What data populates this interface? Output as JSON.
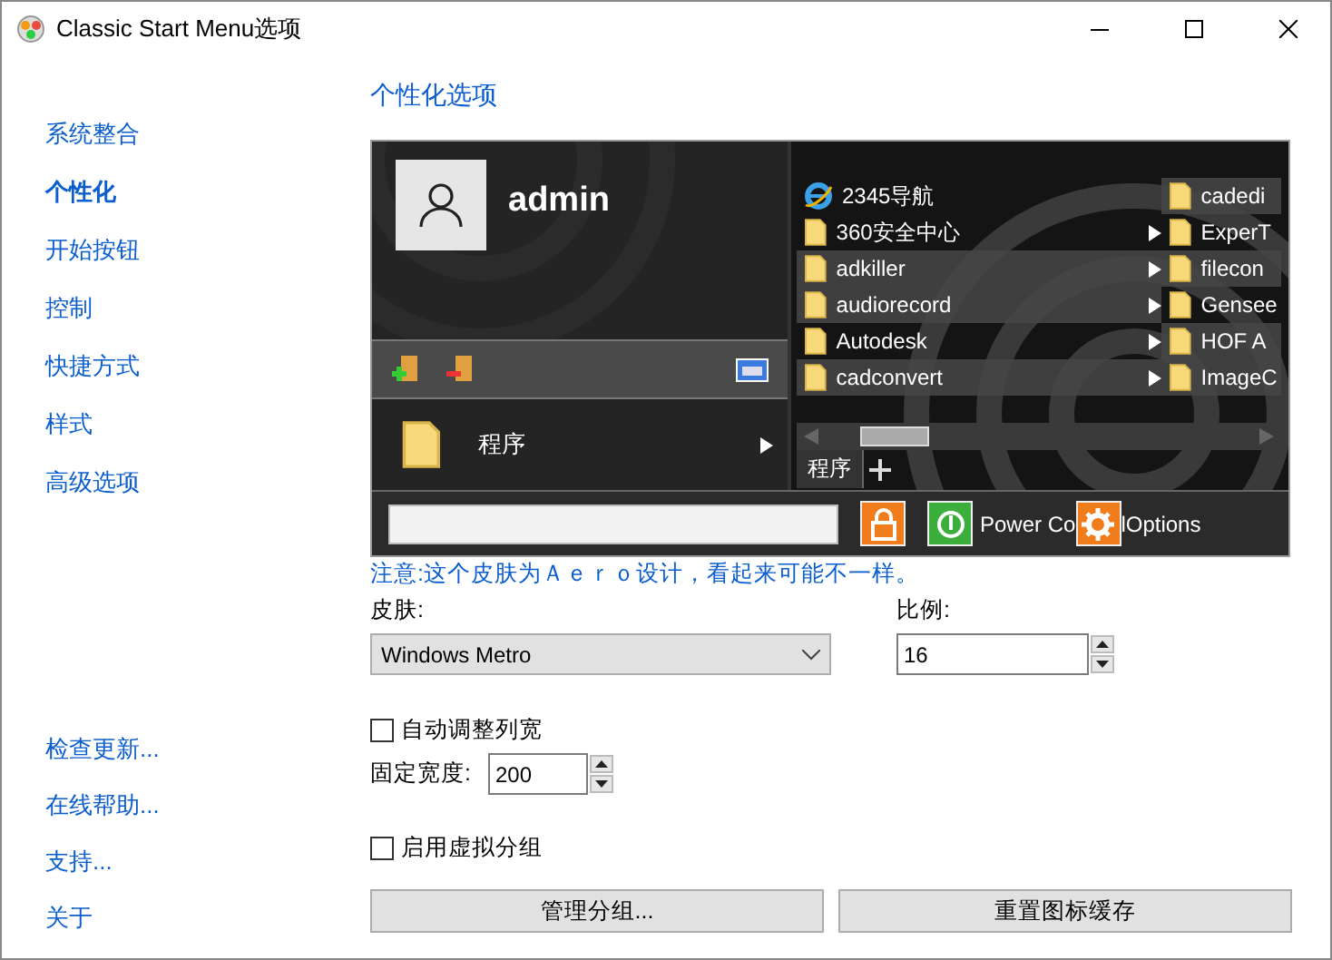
{
  "window": {
    "title": "Classic Start Menu选项"
  },
  "sidebar": {
    "items": [
      {
        "label": "系统整合",
        "selected": false
      },
      {
        "label": "个性化",
        "selected": true
      },
      {
        "label": "开始按钮",
        "selected": false
      },
      {
        "label": "控制",
        "selected": false
      },
      {
        "label": "快捷方式",
        "selected": false
      },
      {
        "label": "样式",
        "selected": false
      },
      {
        "label": "高级选项",
        "selected": false
      }
    ],
    "links": [
      "检查更新...",
      "在线帮助...",
      "支持...",
      "关于"
    ]
  },
  "heading": "个性化选项",
  "preview": {
    "user_name": "admin",
    "programs_label": "程序",
    "column_1": [
      {
        "label": "2345导航",
        "kind": "web",
        "submenu": false,
        "highlighted": false
      },
      {
        "label": "360安全中心",
        "kind": "folder",
        "submenu": true,
        "highlighted": false
      },
      {
        "label": "adkiller",
        "kind": "folder",
        "submenu": true,
        "highlighted": true
      },
      {
        "label": "audiorecord",
        "kind": "folder",
        "submenu": true,
        "highlighted": true
      },
      {
        "label": "Autodesk",
        "kind": "folder",
        "submenu": true,
        "highlighted": false
      },
      {
        "label": "cadconvert",
        "kind": "folder",
        "submenu": true,
        "highlighted": true
      }
    ],
    "column_2": [
      {
        "label": "cadedi",
        "highlighted": true
      },
      {
        "label": "ExperT",
        "highlighted": false
      },
      {
        "label": "filecon",
        "highlighted": true
      },
      {
        "label": "Gensee",
        "highlighted": false
      },
      {
        "label": "HOF A",
        "highlighted": true
      },
      {
        "label": "ImageC",
        "highlighted": true
      }
    ],
    "tab": "程序",
    "power_label_start": "Power Co",
    "power_label_end": "lOptions"
  },
  "note": "注意:这个皮肤为Ａｅｒｏ设计，看起来可能不一样。",
  "skin": {
    "label": "皮肤:",
    "value": "Windows Metro"
  },
  "scale": {
    "label": "比例:",
    "value": "16"
  },
  "auto_width": {
    "label": "自动调整列宽",
    "checked": false
  },
  "fixed_width": {
    "label": "固定宽度:",
    "value": "200"
  },
  "virtual_groups": {
    "label": "启用虚拟分组",
    "checked": false
  },
  "buttons": [
    "管理分组...",
    "重置图标缓存"
  ]
}
